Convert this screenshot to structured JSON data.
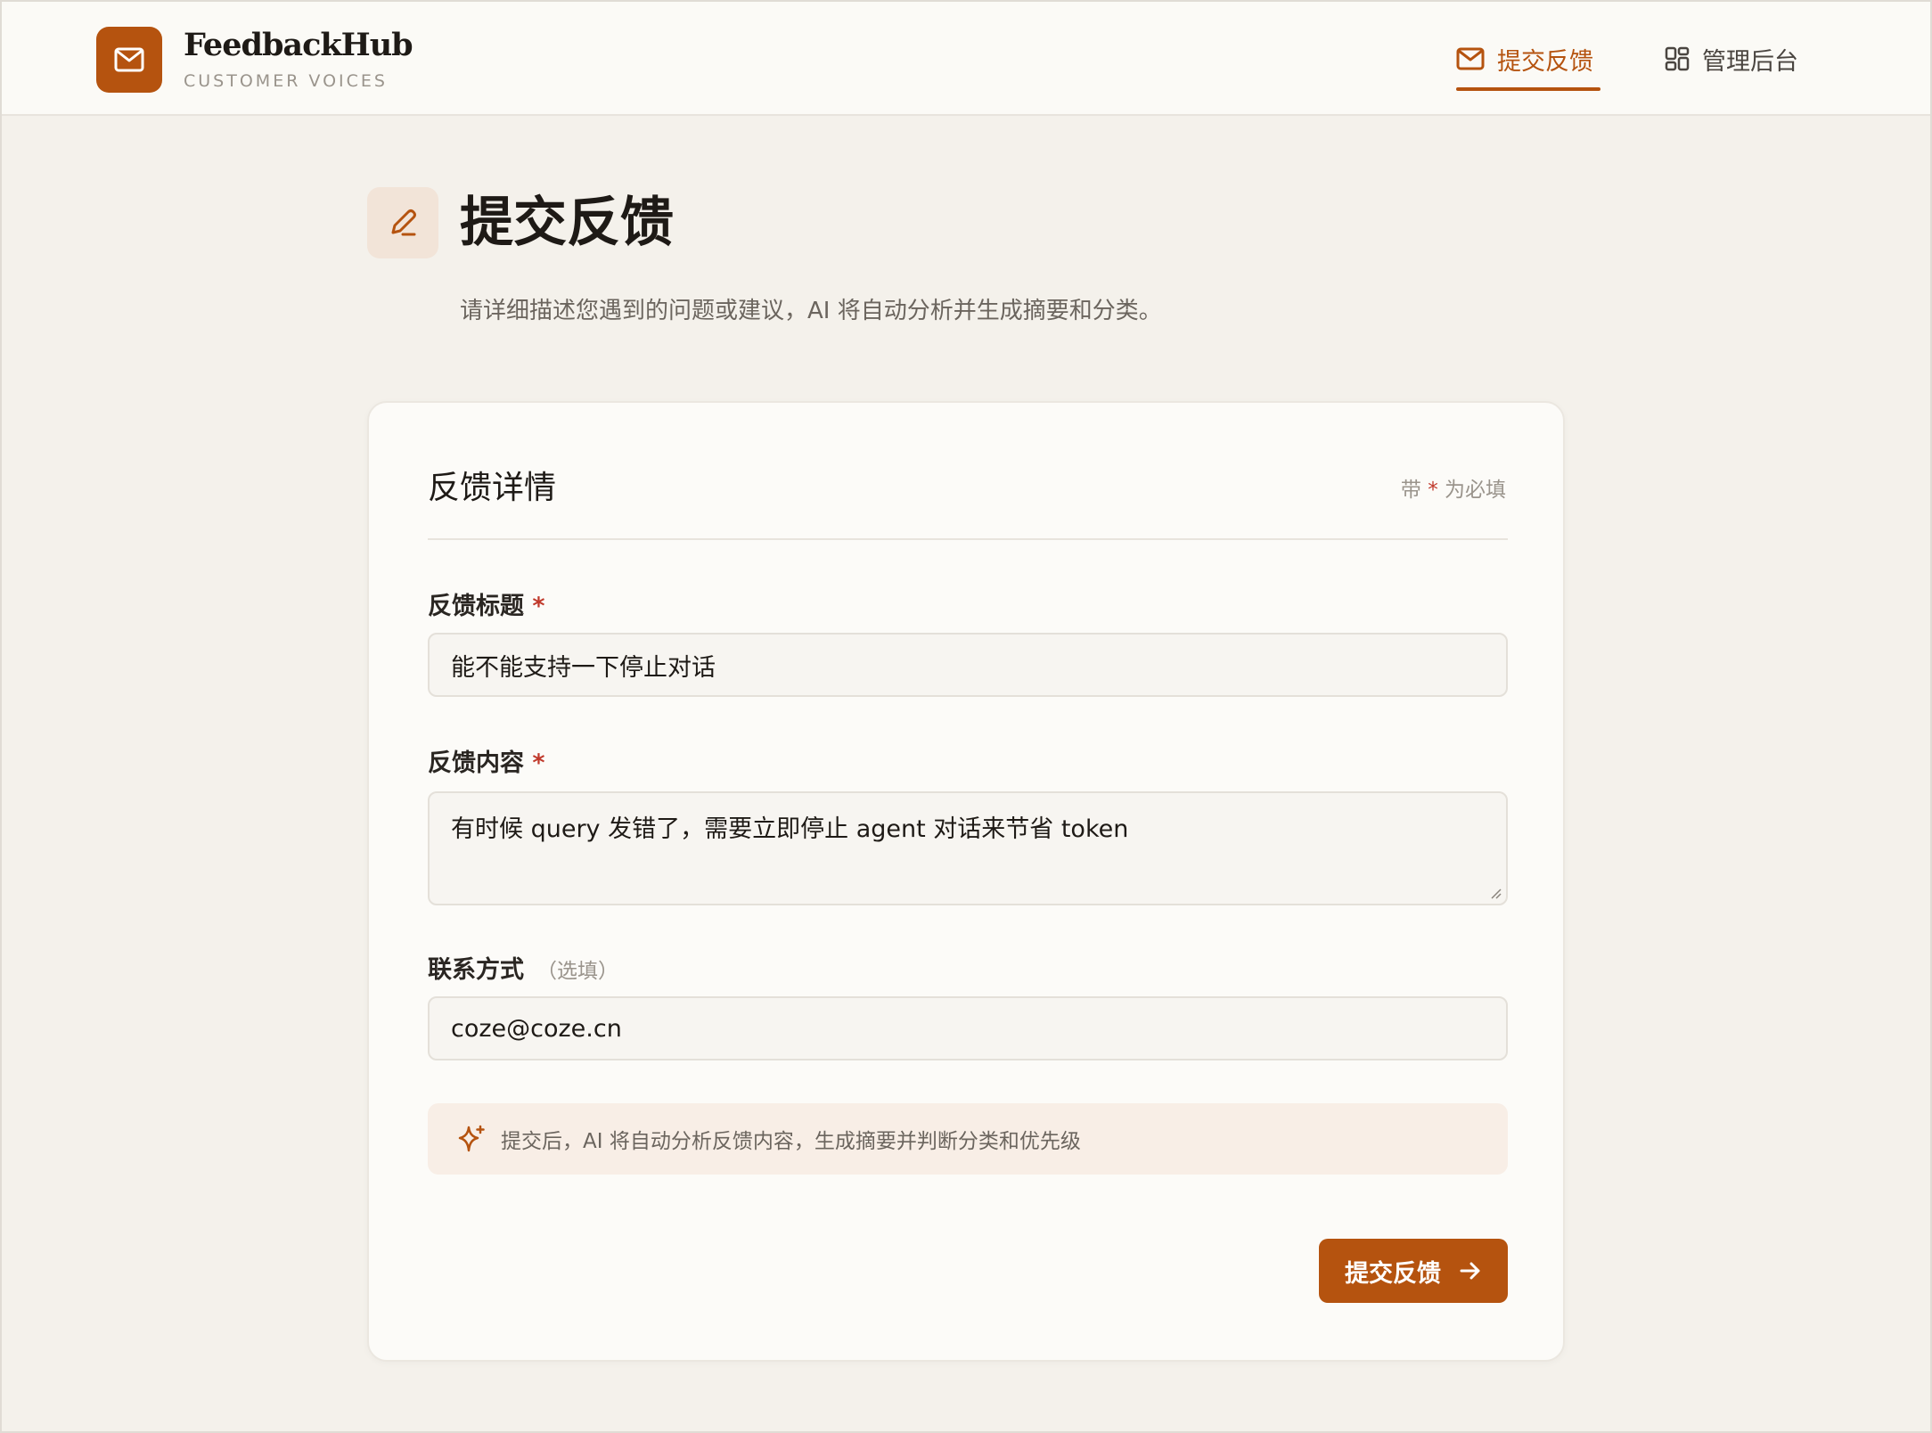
{
  "brand": {
    "name": "FeedbackHub",
    "subtitle": "CUSTOMER VOICES"
  },
  "nav": {
    "submit_label": "提交反馈",
    "admin_label": "管理后台"
  },
  "page": {
    "title": "提交反馈",
    "description": "请详细描述您遇到的问题或建议，AI 将自动分析并生成摘要和分类。"
  },
  "card": {
    "title": "反馈详情",
    "required_prefix": "带",
    "required_star": "*",
    "required_suffix": "为必填"
  },
  "fields": {
    "title_label": "反馈标题",
    "title_value": "能不能支持一下停止对话",
    "content_label": "反馈内容",
    "content_value": "有时候 query 发错了，需要立即停止 agent 对话来节省 token",
    "contact_label": "联系方式",
    "contact_hint": "（选填）",
    "contact_value": "coze@coze.cn",
    "star": "*"
  },
  "ai_tip": "提交后，AI 将自动分析反馈内容，生成摘要并判断分类和优先级",
  "submit_button": "提交反馈",
  "colors": {
    "accent": "#b5530f",
    "background": "#f4f1eb",
    "card": "#fcfbf8"
  }
}
